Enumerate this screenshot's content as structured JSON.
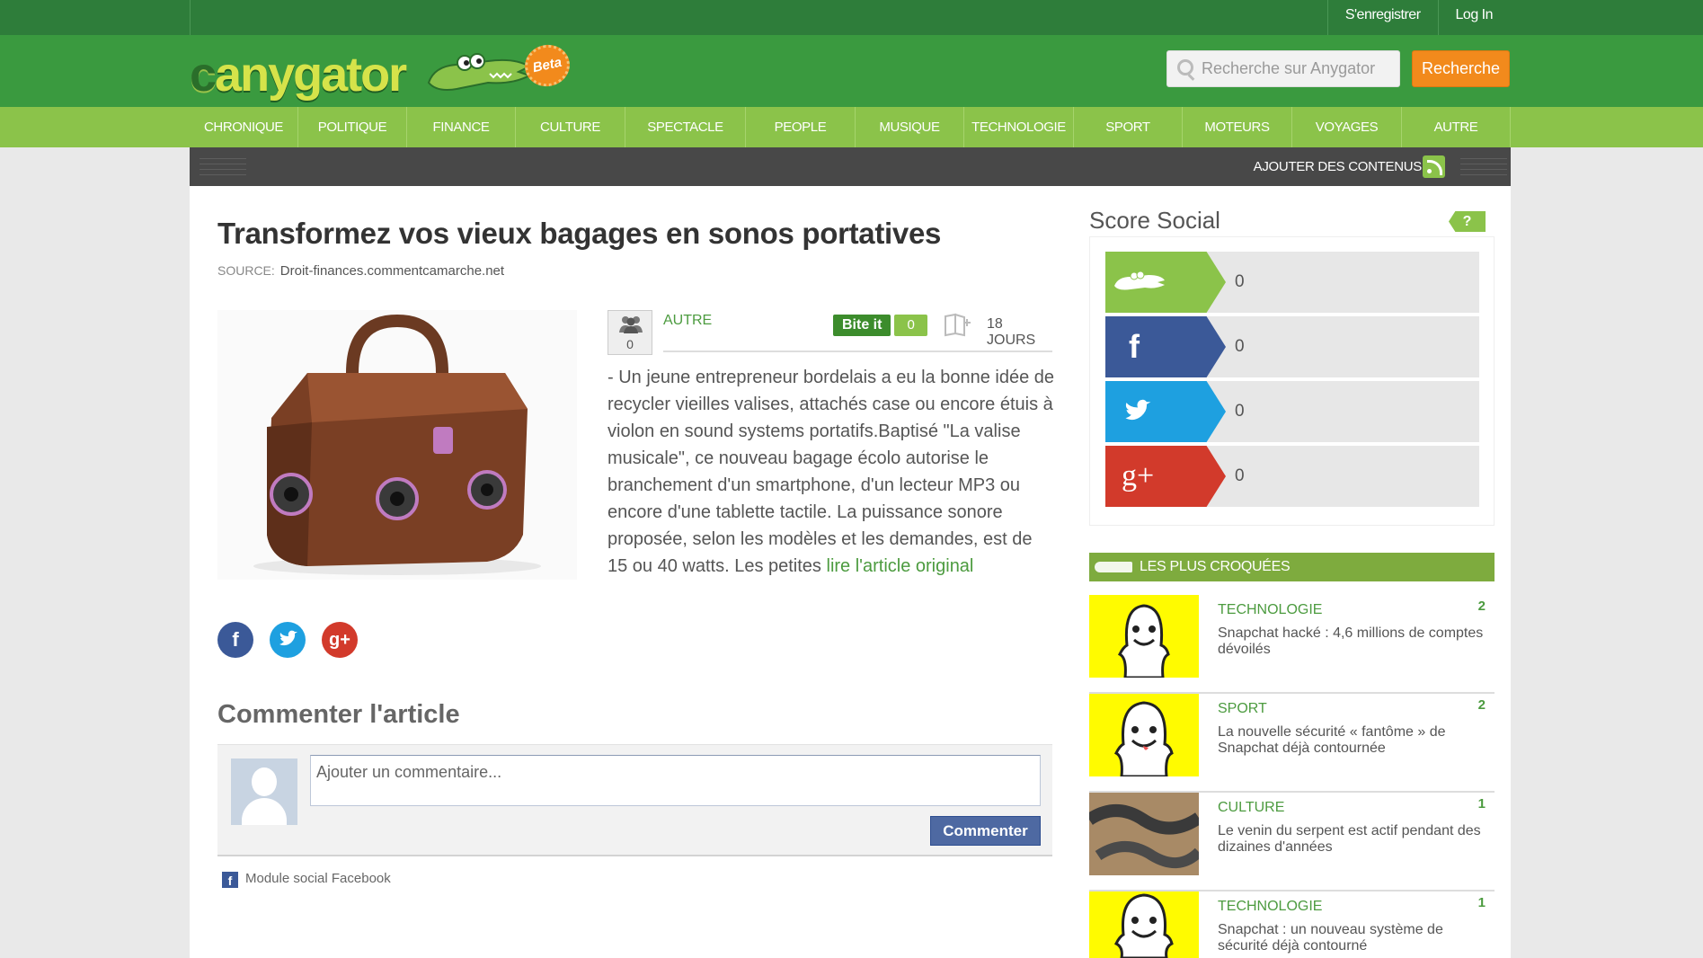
{
  "topbar": {
    "register": "S'enregistrer",
    "login": "Log In"
  },
  "header": {
    "logo_text": "anygator",
    "beta": "Beta",
    "search_placeholder": "Recherche sur Anygator",
    "search_button": "Recherche"
  },
  "nav": [
    "CHRONIQUE",
    "POLITIQUE",
    "FINANCE",
    "CULTURE",
    "SPECTACLE",
    "PEOPLE",
    "MUSIQUE",
    "TECHNOLOGIE",
    "SPORT",
    "MOTEURS",
    "VOYAGES",
    "AUTRE"
  ],
  "subbar": {
    "add_content": "AJOUTER DES CONTENUS"
  },
  "article": {
    "title": "Transformez vos vieux bagages en sonos portatives",
    "source_label": "SOURCE:",
    "source": "Droit-finances.commentcamarche.net",
    "people_count": "0",
    "category": "AUTRE",
    "bite_label": "Bite it",
    "bite_count": "0",
    "age": "18 JOURS",
    "body": "- Un jeune entrepreneur bordelais a eu la bonne idée de recycler vieilles valises, attachés case ou encore étuis à violon en sound systems portatifs.Baptisé \"La valise musicale\", ce nouveau bagage écolo autorise le branchement d'un smartphone, d'un lecteur MP3 ou encore d'une tablette tactile. La puissance sonore proposée, selon les modèles et les demandes, est de 15 ou 40 watts. Les petites ",
    "read_more": "lire l'article original"
  },
  "comments": {
    "heading": "Commenter l'article",
    "placeholder": "Ajouter un commentaire...",
    "button": "Commenter",
    "fb_module": "Module social Facebook"
  },
  "social_score": {
    "title": "Score Social",
    "help": "?",
    "rows": [
      {
        "name": "anygator",
        "value": "0",
        "color": "#8bc34a"
      },
      {
        "name": "facebook",
        "value": "0",
        "color": "#3b5998"
      },
      {
        "name": "twitter",
        "value": "0",
        "color": "#1ea0e0"
      },
      {
        "name": "google-plus",
        "value": "0",
        "color": "#d23a2b"
      }
    ]
  },
  "most_croqued": {
    "title": "LES PLUS CROQUÉES",
    "items": [
      {
        "category": "TECHNOLOGIE",
        "score": "2",
        "title": "Snapchat hacké : 4,6 millions de comptes dévoilés"
      },
      {
        "category": "SPORT",
        "score": "2",
        "title": "La nouvelle sécurité « fantôme » de Snapchat déjà contournée"
      },
      {
        "category": "CULTURE",
        "score": "1",
        "title": "Le venin du serpent est actif pendant des dizaines d'années"
      },
      {
        "category": "TECHNOLOGIE",
        "score": "1",
        "title": "Snapchat : un nouveau système de sécurité déjà contourné"
      }
    ]
  },
  "colors": {
    "green_dark": "#2e7d3a",
    "green": "#3a9a3f",
    "green_light": "#8bc34a",
    "orange": "#f28a1c",
    "fb_blue": "#4e69a2"
  }
}
